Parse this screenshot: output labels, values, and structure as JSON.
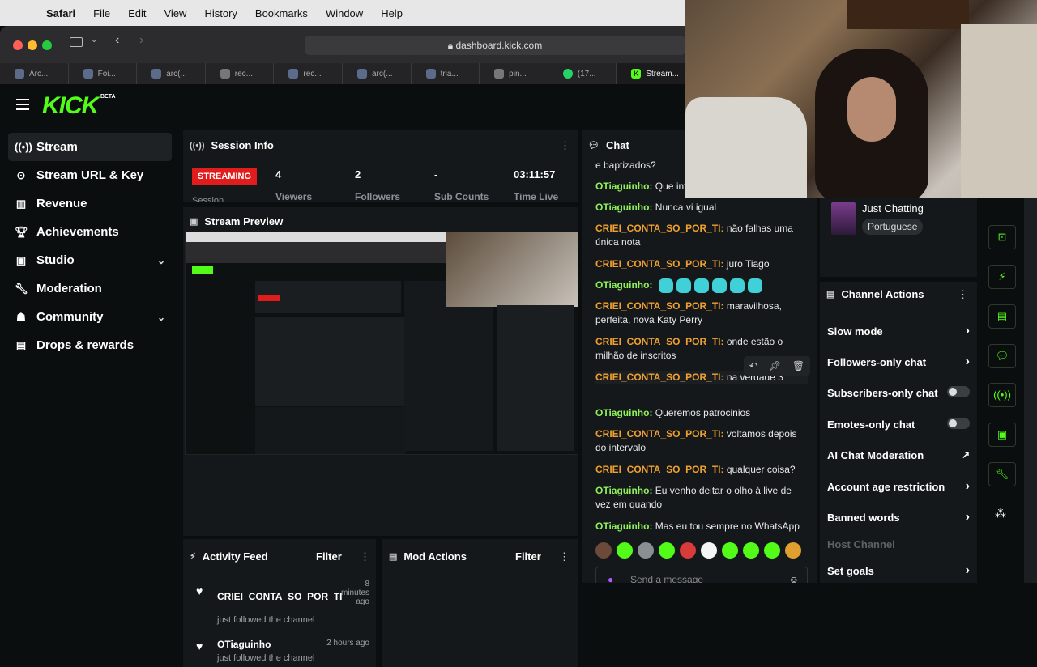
{
  "menubar": {
    "items": [
      "Safari",
      "File",
      "Edit",
      "View",
      "History",
      "Bookmarks",
      "Window",
      "Help"
    ]
  },
  "browser": {
    "url": "dashboard.kick.com",
    "tabs": [
      {
        "label": "Arc...",
        "icon": "app-icon"
      },
      {
        "label": "Foi...",
        "icon": "doc-icon"
      },
      {
        "label": "arc(...",
        "icon": "app-icon"
      },
      {
        "label": "rec...",
        "icon": "google-icon"
      },
      {
        "label": "rec...",
        "icon": "app-icon"
      },
      {
        "label": "arc(...",
        "icon": "app-icon"
      },
      {
        "label": "tria...",
        "icon": "app-icon"
      },
      {
        "label": "pin...",
        "icon": "google-icon"
      },
      {
        "label": "(17...",
        "icon": "whatsapp-icon"
      },
      {
        "label": "Stream...",
        "icon": "kick-icon"
      }
    ]
  },
  "kick": {
    "logo": "KICK",
    "beta": "BETA"
  },
  "sidebar": {
    "items": [
      {
        "label": "Stream",
        "icon": "stream-icon"
      },
      {
        "label": "Stream URL & Key",
        "icon": "key-icon"
      },
      {
        "label": "Revenue",
        "icon": "revenue-icon"
      },
      {
        "label": "Achievements",
        "icon": "trophy-icon"
      },
      {
        "label": "Studio",
        "icon": "studio-icon"
      },
      {
        "label": "Moderation",
        "icon": "wrench-icon"
      },
      {
        "label": "Community",
        "icon": "community-icon"
      },
      {
        "label": "Drops & rewards",
        "icon": "gift-icon"
      }
    ]
  },
  "session": {
    "title": "Session Info",
    "badge": "STREAMING",
    "badge_sub": "Session",
    "viewers": "4",
    "viewers_label": "Viewers",
    "followers": "2",
    "followers_label": "Followers",
    "subs": "-",
    "subs_label": "Sub Counts",
    "time": "03:11:57",
    "time_label": "Time Live"
  },
  "preview": {
    "title": "Stream Preview"
  },
  "activity": {
    "title": "Activity Feed",
    "filter": "Filter",
    "items": [
      {
        "user": "CRIEI_CONTA_SO_POR_TI",
        "text": "just followed the channel",
        "time": "8 minutes ago"
      },
      {
        "user": "OTiaguinho",
        "text": "just followed the channel",
        "time": "2 hours ago"
      }
    ]
  },
  "mod": {
    "title": "Mod Actions",
    "filter": "Filter"
  },
  "chat": {
    "title": "Chat",
    "messages": [
      {
        "user": "",
        "text": "e baptizados?",
        "color": "none"
      },
      {
        "user": "OTiaguinho",
        "text": "Que inte",
        "color": "green"
      },
      {
        "user": "OTiaguinho",
        "text": "Nunca vi igual",
        "color": "green"
      },
      {
        "user": "CRIEI_CONTA_SO_POR_TI",
        "text": "não falhas uma única nota",
        "color": "orange"
      },
      {
        "user": "CRIEI_CONTA_SO_POR_TI",
        "text": "juro Tiago",
        "color": "orange"
      },
      {
        "user": "OTiaguinho",
        "text": "",
        "color": "green"
      },
      {
        "user": "CRIEI_CONTA_SO_POR_TI",
        "text": "maravilhosa, perfeita, nova Katy Perry",
        "color": "orange"
      },
      {
        "user": "CRIEI_CONTA_SO_POR_TI",
        "text": "onde estão o milhão de inscritos",
        "color": "orange"
      },
      {
        "user": "CRIEI_CONTA_SO_POR_TI",
        "text": "na verdade 3",
        "color": "orange"
      },
      {
        "user": "OTiaguinho",
        "text": "Queremos patrocinios",
        "color": "green"
      },
      {
        "user": "CRIEI_CONTA_SO_POR_TI",
        "text": "voltamos depois do intervalo",
        "color": "orange"
      },
      {
        "user": "CRIEI_CONTA_SO_POR_TI",
        "text": "qualquer coisa?",
        "color": "orange"
      },
      {
        "user": "OTiaguinho",
        "text": "Eu venho deitar o olho à live de vez em quando",
        "color": "green"
      },
      {
        "user": "OTiaguinho",
        "text": "Mas eu tou sempre no WhatsApp",
        "color": "green"
      }
    ],
    "placeholder": "Send a message"
  },
  "category": {
    "name": "Just Chatting",
    "language": "Portuguese"
  },
  "channel_actions": {
    "title": "Channel Actions",
    "items": [
      {
        "label": "Slow mode",
        "control": "arrow"
      },
      {
        "label": "Followers-only chat",
        "control": "arrow"
      },
      {
        "label": "Subscribers-only chat",
        "control": "toggle"
      },
      {
        "label": "Emotes-only chat",
        "control": "toggle"
      },
      {
        "label": "AI Chat Moderation",
        "control": "external"
      },
      {
        "label": "Account age restriction",
        "control": "arrow"
      },
      {
        "label": "Banned words",
        "control": "arrow"
      },
      {
        "label": "Host Channel",
        "control": "none"
      },
      {
        "label": "Set goals",
        "control": "arrow"
      }
    ]
  },
  "colors": {
    "kick_green": "#53fc18",
    "streaming_red": "#e01c1c",
    "orange_user": "#f0a030",
    "green_user": "#8ff05a"
  }
}
